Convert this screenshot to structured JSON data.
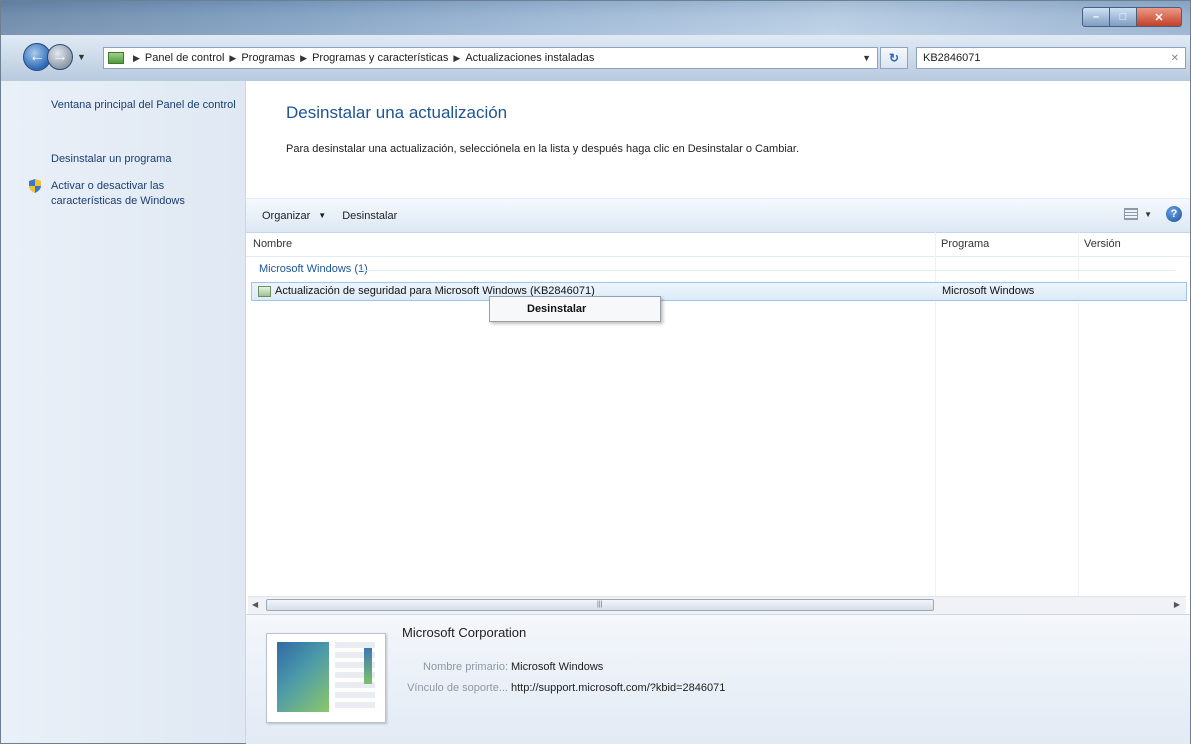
{
  "window": {
    "address_crumbs": [
      "Panel de control",
      "Programas",
      "Programas y características",
      "Actualizaciones instaladas"
    ],
    "search_value": "KB2846071"
  },
  "sidebar": {
    "items": [
      {
        "label": "Ventana principal del Panel de control"
      },
      {
        "label": "Desinstalar un programa"
      },
      {
        "label": "Activar o desactivar las características de Windows"
      }
    ]
  },
  "main": {
    "title": "Desinstalar una actualización",
    "description": "Para desinstalar una actualización, selecciónela en la lista y después haga clic en Desinstalar o Cambiar.",
    "toolbar": {
      "organize": "Organizar",
      "uninstall": "Desinstalar"
    },
    "columns": [
      "Nombre",
      "Programa",
      "Versión"
    ],
    "group": "Microsoft Windows (1)",
    "rows": [
      {
        "name": "Actualización de seguridad para Microsoft Windows (KB2846071)",
        "program": "Microsoft Windows"
      }
    ]
  },
  "context_menu": {
    "items": [
      "Desinstalar"
    ]
  },
  "details": {
    "company": "Microsoft Corporation",
    "primary_name_label": "Nombre primario:",
    "primary_name": "Microsoft Windows",
    "support_link_label": "Vínculo de soporte...",
    "support_link": "http://support.microsoft.com/?kbid=2846071"
  },
  "colors": {
    "accent": "#1d5591",
    "selection": "#dbeaf8",
    "link": "#1a3e72"
  },
  "icons": [
    "back-icon",
    "forward-icon",
    "control-panel-icon",
    "refresh-icon",
    "shield-icon",
    "views-icon",
    "help-icon",
    "update-icon"
  ]
}
